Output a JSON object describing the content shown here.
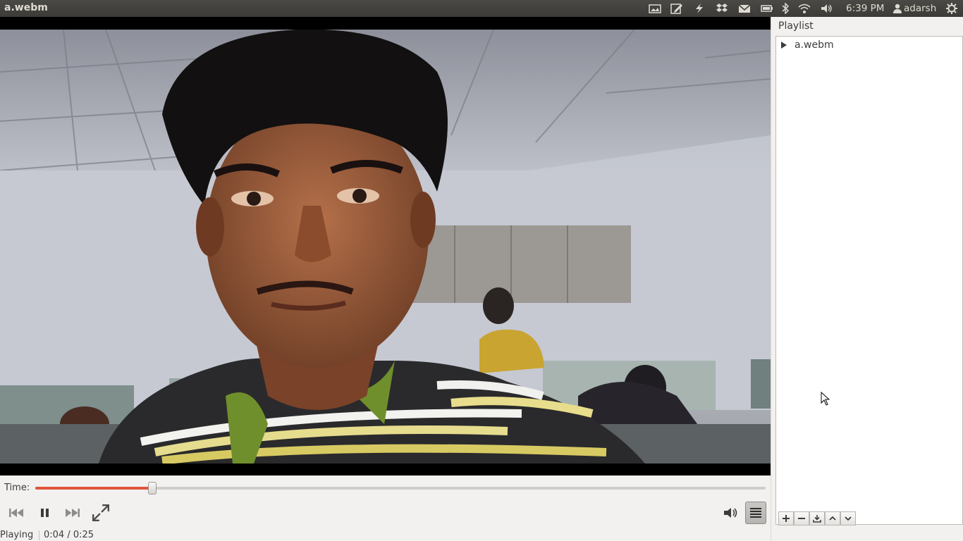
{
  "window": {
    "title": "a.webm"
  },
  "top_panel": {
    "clock": "6:39 PM",
    "user": "adarsh",
    "tray_icons": [
      "photo-icon",
      "edit-icon",
      "flash-icon",
      "dropbox-icon",
      "mail-icon",
      "battery-icon",
      "bluetooth-icon",
      "wifi-icon",
      "volume-icon"
    ]
  },
  "player": {
    "time_label": "Time:",
    "progress": 0.16,
    "status": "Playing",
    "position": "0:04 / 0:25"
  },
  "playlist": {
    "title": "Playlist",
    "items": [
      {
        "label": "a.webm"
      }
    ]
  },
  "colors": {
    "panel_bg": "#3c3b37",
    "seek_fill": "#e0553a",
    "window_bg": "#f2f1f0"
  }
}
